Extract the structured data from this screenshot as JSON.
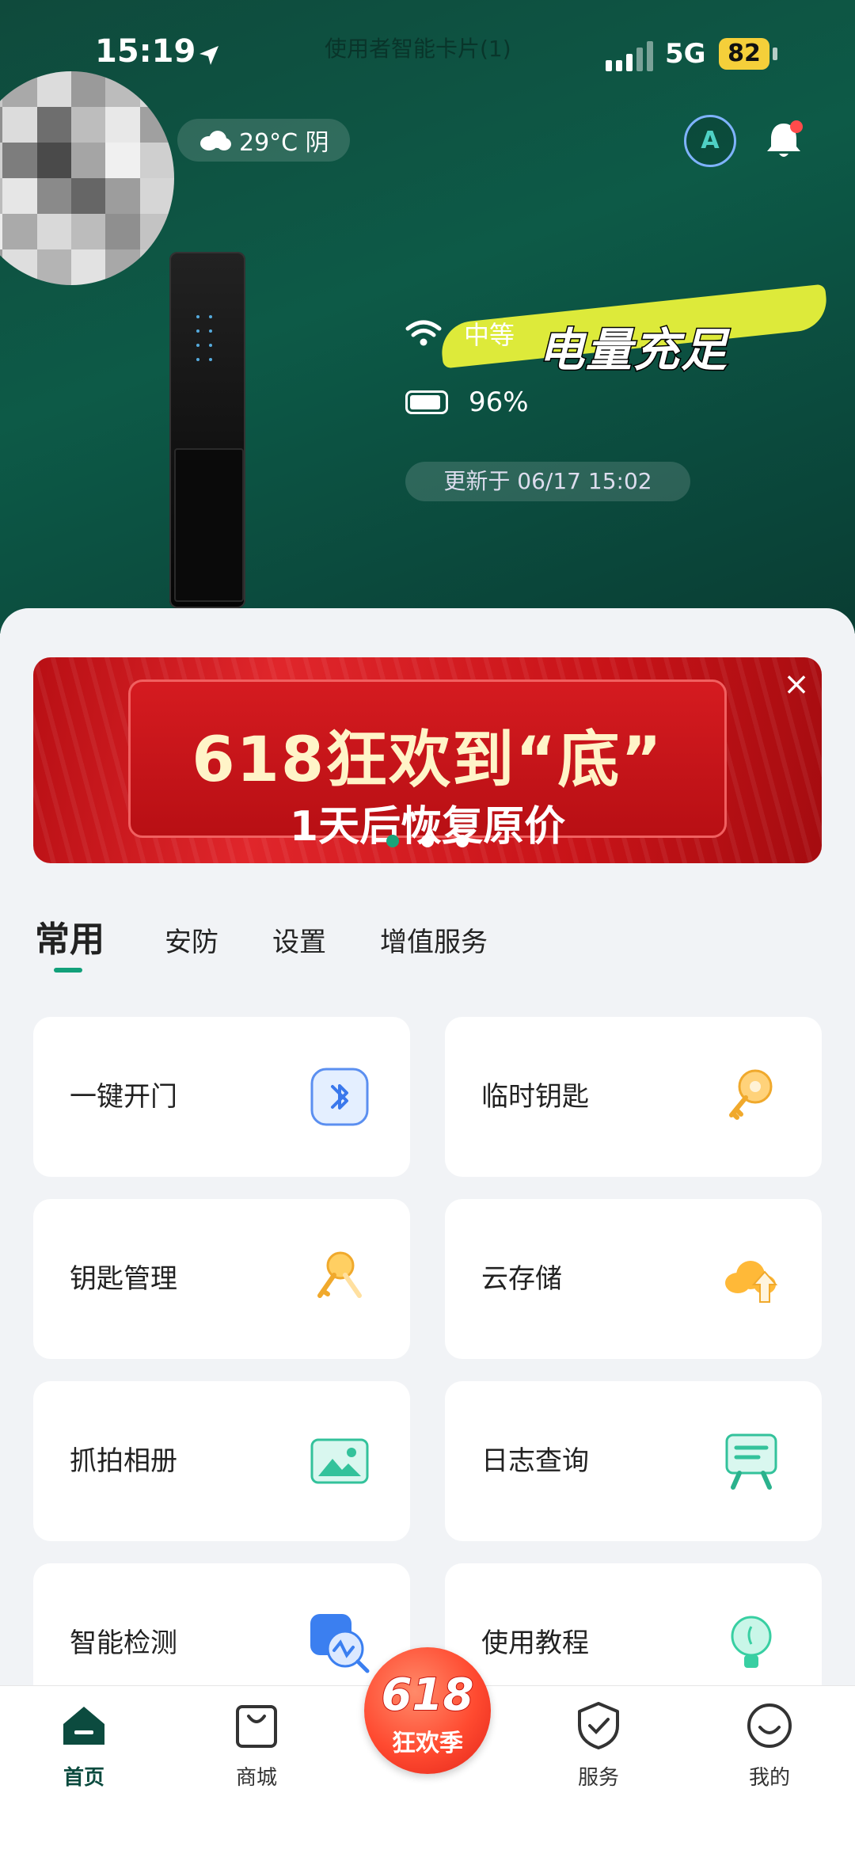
{
  "status_bar": {
    "time": "15:19",
    "faint_text": "使用者智能卡片(1)",
    "network": "5G",
    "battery": "82"
  },
  "weather": {
    "text": "29°C 阴"
  },
  "assistant": {
    "label": "A"
  },
  "device": {
    "wifi_text": "中等",
    "battery_percent": "96%",
    "sticker_text": "电量充足",
    "updated_text": "更新于 06/17 15:02"
  },
  "banner": {
    "line1": "618狂欢到“底”",
    "line2": "1天后恢复原价",
    "close": "×",
    "page_index": 1,
    "page_count": 3
  },
  "tabs": [
    {
      "label": "常用",
      "active": true
    },
    {
      "label": "安防",
      "active": false
    },
    {
      "label": "设置",
      "active": false
    },
    {
      "label": "增值服务",
      "active": false
    }
  ],
  "features": [
    {
      "label": "一键开门",
      "icon": "bluetooth-icon"
    },
    {
      "label": "临时钥匙",
      "icon": "key-icon"
    },
    {
      "label": "钥匙管理",
      "icon": "keys-icon"
    },
    {
      "label": "云存储",
      "icon": "cloud-upload-icon"
    },
    {
      "label": "抓拍相册",
      "icon": "photo-album-icon"
    },
    {
      "label": "日志查询",
      "icon": "log-icon"
    },
    {
      "label": "智能检测",
      "icon": "smart-detect-icon"
    },
    {
      "label": "使用教程",
      "icon": "lightbulb-icon"
    }
  ],
  "bottom_nav": {
    "home": "首页",
    "mall": "商城",
    "promo_big": "618",
    "promo_small": "狂欢季",
    "service": "服务",
    "mine": "我的"
  },
  "colors": {
    "accent": "#12a07a",
    "hero": "#0d5a47",
    "promo": "#e2251a"
  }
}
